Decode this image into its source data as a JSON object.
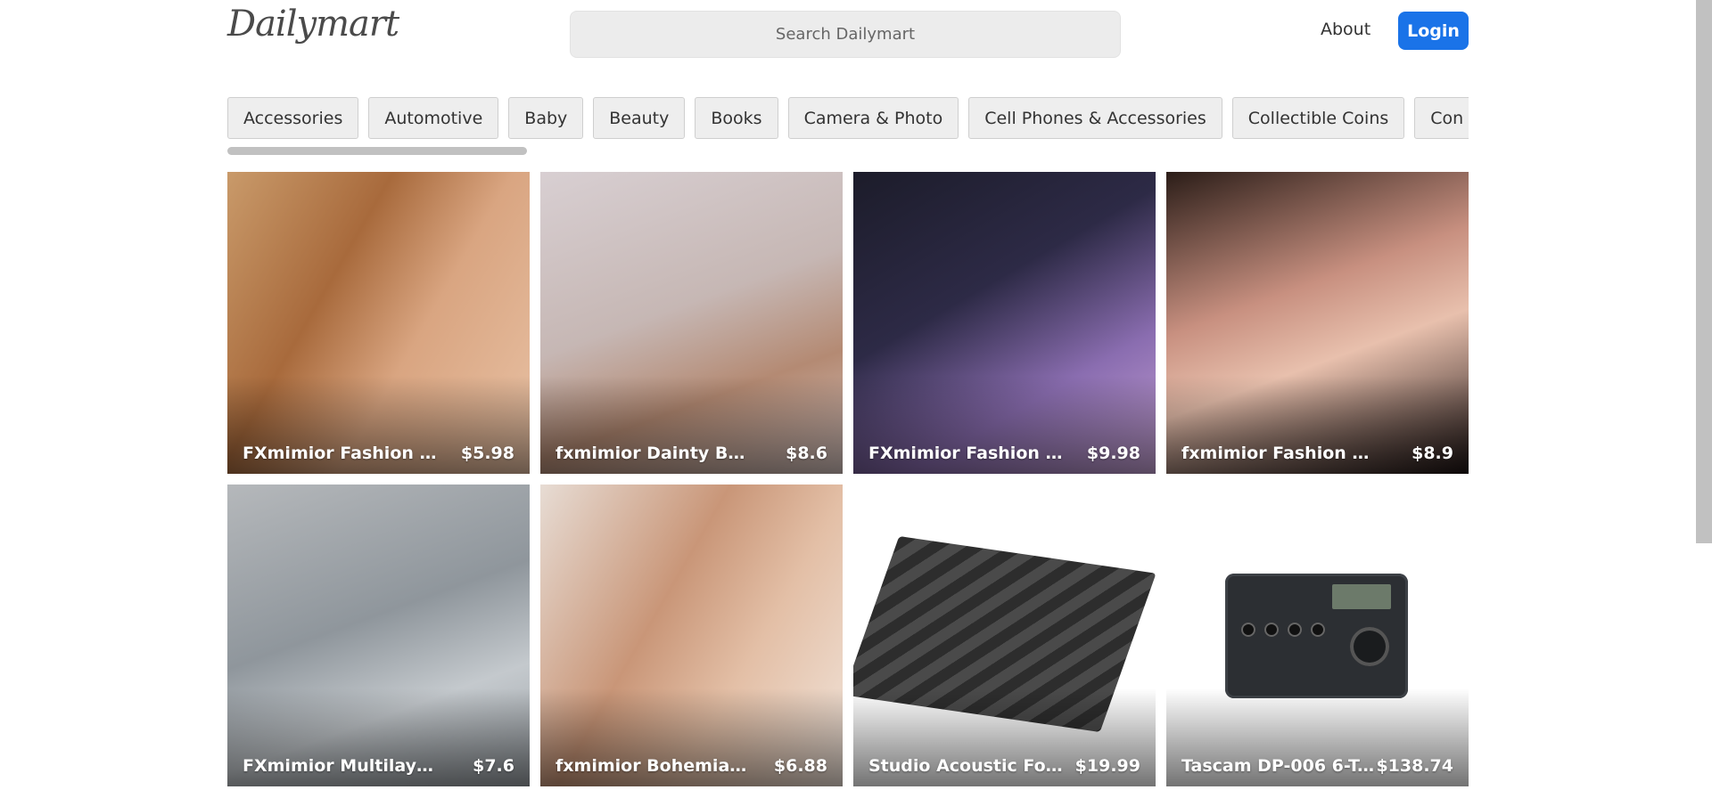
{
  "header": {
    "logo": "Dailymart",
    "search_placeholder": "Search Dailymart",
    "about_label": "About",
    "login_label": "Login"
  },
  "categories": [
    "Accessories",
    "Automotive",
    "Baby",
    "Beauty",
    "Books",
    "Camera & Photo",
    "Cell Phones & Accessories",
    "Collectible Coins",
    "Con"
  ],
  "products": [
    {
      "title": "FXmimior Fashion W...",
      "price": "$5.98"
    },
    {
      "title": "fxmimior Dainty Boho ...",
      "price": "$8.6"
    },
    {
      "title": "FXmimior Fashion W...",
      "price": "$9.98"
    },
    {
      "title": "fxmimior Fashion Wo...",
      "price": "$8.9"
    },
    {
      "title": "FXmimior Multilayer N...",
      "price": "$7.6"
    },
    {
      "title": "fxmimior Bohemian ...",
      "price": "$6.88"
    },
    {
      "title": "Studio Acoustic Foa...",
      "price": "$19.99"
    },
    {
      "title": "Tascam DP-006 6-T...",
      "price": "$138.74"
    }
  ],
  "colors": {
    "accent": "#1a73e8",
    "search_bg": "#ececec",
    "category_bg": "#eeeeee"
  }
}
